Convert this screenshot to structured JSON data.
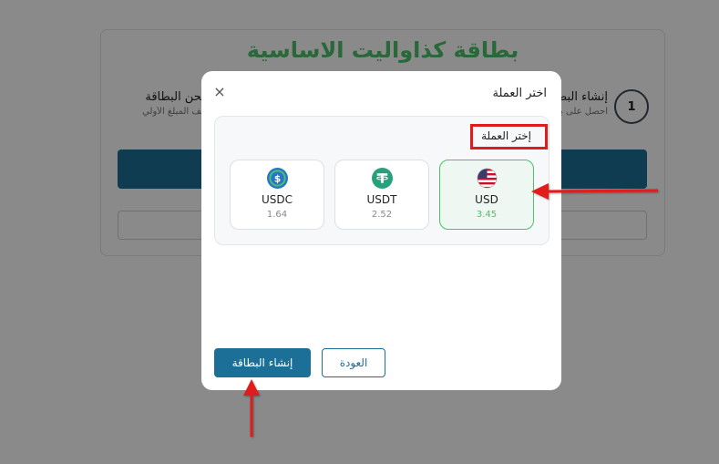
{
  "background": {
    "title": "بطاقة كذاواليت الاساسية",
    "step_number": "1",
    "step1_title": "إنشاء البطاقة",
    "step1_sub": "احصل على بطاقتك",
    "step2_title": "شحن البطاقة",
    "step2_sub": "أضف المبلغ الأولي"
  },
  "modal": {
    "title": "اختر العملة",
    "close_icon": "×",
    "panel_label": "إختر العملة",
    "currencies": [
      {
        "code": "USD",
        "rate": "3.45",
        "icon": "us-flag-icon",
        "selected": true
      },
      {
        "code": "USDT",
        "rate": "2.52",
        "icon": "tether-icon",
        "selected": false
      },
      {
        "code": "USDC",
        "rate": "1.64",
        "icon": "usdc-icon",
        "selected": false
      }
    ],
    "create_button": "إنشاء البطاقة",
    "back_button": "العودة"
  },
  "colors": {
    "accent": "#1c6f96",
    "brand_green": "#4cc06a",
    "annotation_red": "#e01b1b"
  }
}
